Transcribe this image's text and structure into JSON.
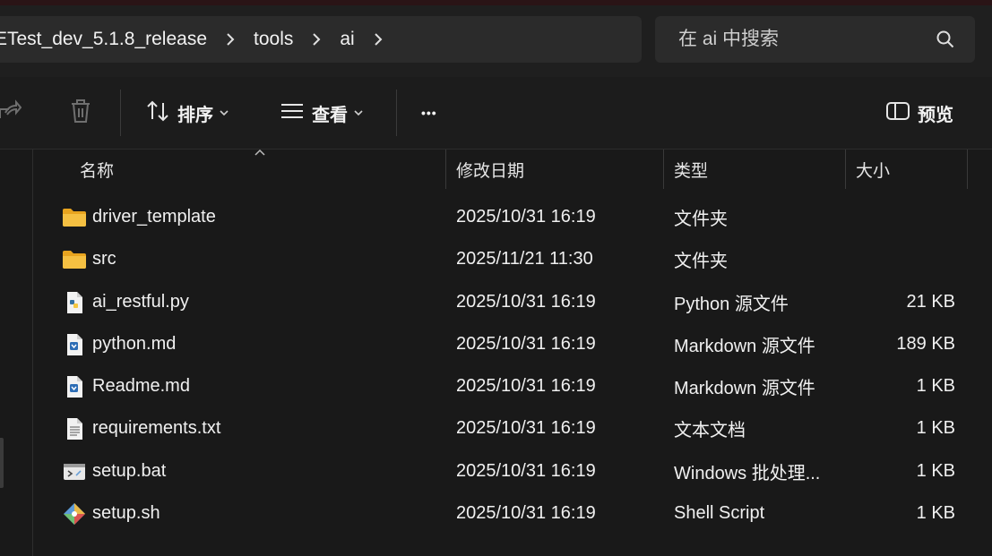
{
  "address": {
    "crumbs": [
      "ETest_dev_5.1.8_release",
      "tools",
      "ai"
    ]
  },
  "search": {
    "placeholder": "在 ai 中搜索"
  },
  "toolbar": {
    "sort_label": "排序",
    "view_label": "查看",
    "more_label": "•••",
    "preview_label": "预览"
  },
  "columns": {
    "name": "名称",
    "modified": "修改日期",
    "type": "类型",
    "size": "大小"
  },
  "files": [
    {
      "name": "driver_template",
      "modified": "2025/10/31 16:19",
      "type": "文件夹",
      "size": "",
      "icon": "folder-icon"
    },
    {
      "name": "src",
      "modified": "2025/11/21 11:30",
      "type": "文件夹",
      "size": "",
      "icon": "folder-icon"
    },
    {
      "name": "ai_restful.py",
      "modified": "2025/10/31 16:19",
      "type": "Python 源文件",
      "size": "21 KB",
      "icon": "python-file-icon"
    },
    {
      "name": "python.md",
      "modified": "2025/10/31 16:19",
      "type": "Markdown 源文件",
      "size": "189 KB",
      "icon": "markdown-file-icon"
    },
    {
      "name": "Readme.md",
      "modified": "2025/10/31 16:19",
      "type": "Markdown 源文件",
      "size": "1 KB",
      "icon": "markdown-file-icon"
    },
    {
      "name": "requirements.txt",
      "modified": "2025/10/31 16:19",
      "type": "文本文档",
      "size": "1 KB",
      "icon": "text-file-icon"
    },
    {
      "name": "setup.bat",
      "modified": "2025/10/31 16:19",
      "type": "Windows 批处理...",
      "size": "1 KB",
      "icon": "batch-file-icon"
    },
    {
      "name": "setup.sh",
      "modified": "2025/10/31 16:19",
      "type": "Shell Script",
      "size": "1 KB",
      "icon": "shell-script-icon"
    }
  ],
  "colors": {
    "folder": "#f5c042",
    "background": "#191919",
    "accent": "#4fa3e0"
  }
}
